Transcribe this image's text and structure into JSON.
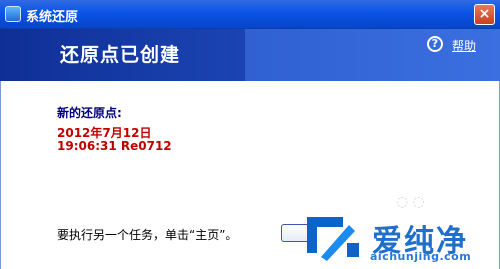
{
  "window": {
    "title": "系统还原",
    "close_label": "×"
  },
  "header": {
    "title": "还原点已创建",
    "help_icon": "?",
    "help_label": "帮助"
  },
  "restore_point": {
    "label": "新的还原点:",
    "date": "2012年7月12日",
    "time_name": "19:06:31  Re0712"
  },
  "footer": {
    "instruction": "要执行另一个任务，单击“主页”。"
  },
  "watermark": {
    "brand": "爱纯净",
    "url": "aichunjing.com",
    "deco": "◌ ◌"
  },
  "colors": {
    "titlebar": "#0a54e6",
    "banner": "#1b44b3",
    "accent_red": "#c00000",
    "label_navy": "#000080"
  }
}
